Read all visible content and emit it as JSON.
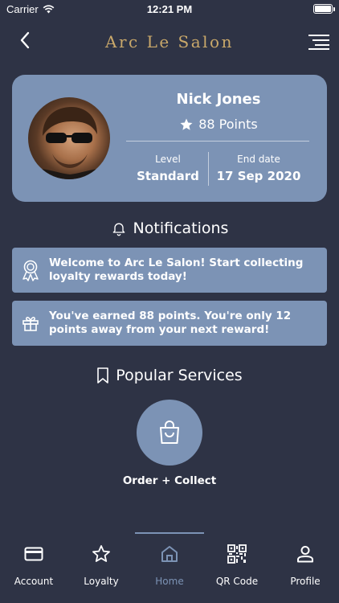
{
  "status_bar": {
    "carrier": "Carrier",
    "time": "12:21 PM"
  },
  "header": {
    "brand": "Arc Le Salon",
    "back_icon": "chevron-left-icon",
    "menu_icon": "menu-icon"
  },
  "profile": {
    "name": "Nick Jones",
    "points": "88 Points",
    "level_label": "Level",
    "level_value": "Standard",
    "end_date_label": "End date",
    "end_date_value": "17 Sep 2020"
  },
  "notifications": {
    "title": "Notifications",
    "items": [
      {
        "icon": "award-ribbon-icon",
        "text": "Welcome to Arc Le Salon! Start collecting loyalty rewards today!"
      },
      {
        "icon": "gift-icon",
        "text": "You've earned 88 points. You're only 12 points away from your next reward!"
      }
    ]
  },
  "services": {
    "title": "Popular Services",
    "items": [
      {
        "icon": "shopping-bag-icon",
        "label": "Order + Collect"
      }
    ]
  },
  "tabs": [
    {
      "label": "Account",
      "icon": "card-icon"
    },
    {
      "label": "Loyalty",
      "icon": "star-icon"
    },
    {
      "label": "Home",
      "icon": "home-icon",
      "active": true
    },
    {
      "label": "QR Code",
      "icon": "qr-code-icon"
    },
    {
      "label": "Profile",
      "icon": "user-icon"
    }
  ],
  "colors": {
    "background": "#2e3345",
    "card": "#7c93b5",
    "brand_gold": "#c9a86a",
    "text": "#ffffff"
  }
}
